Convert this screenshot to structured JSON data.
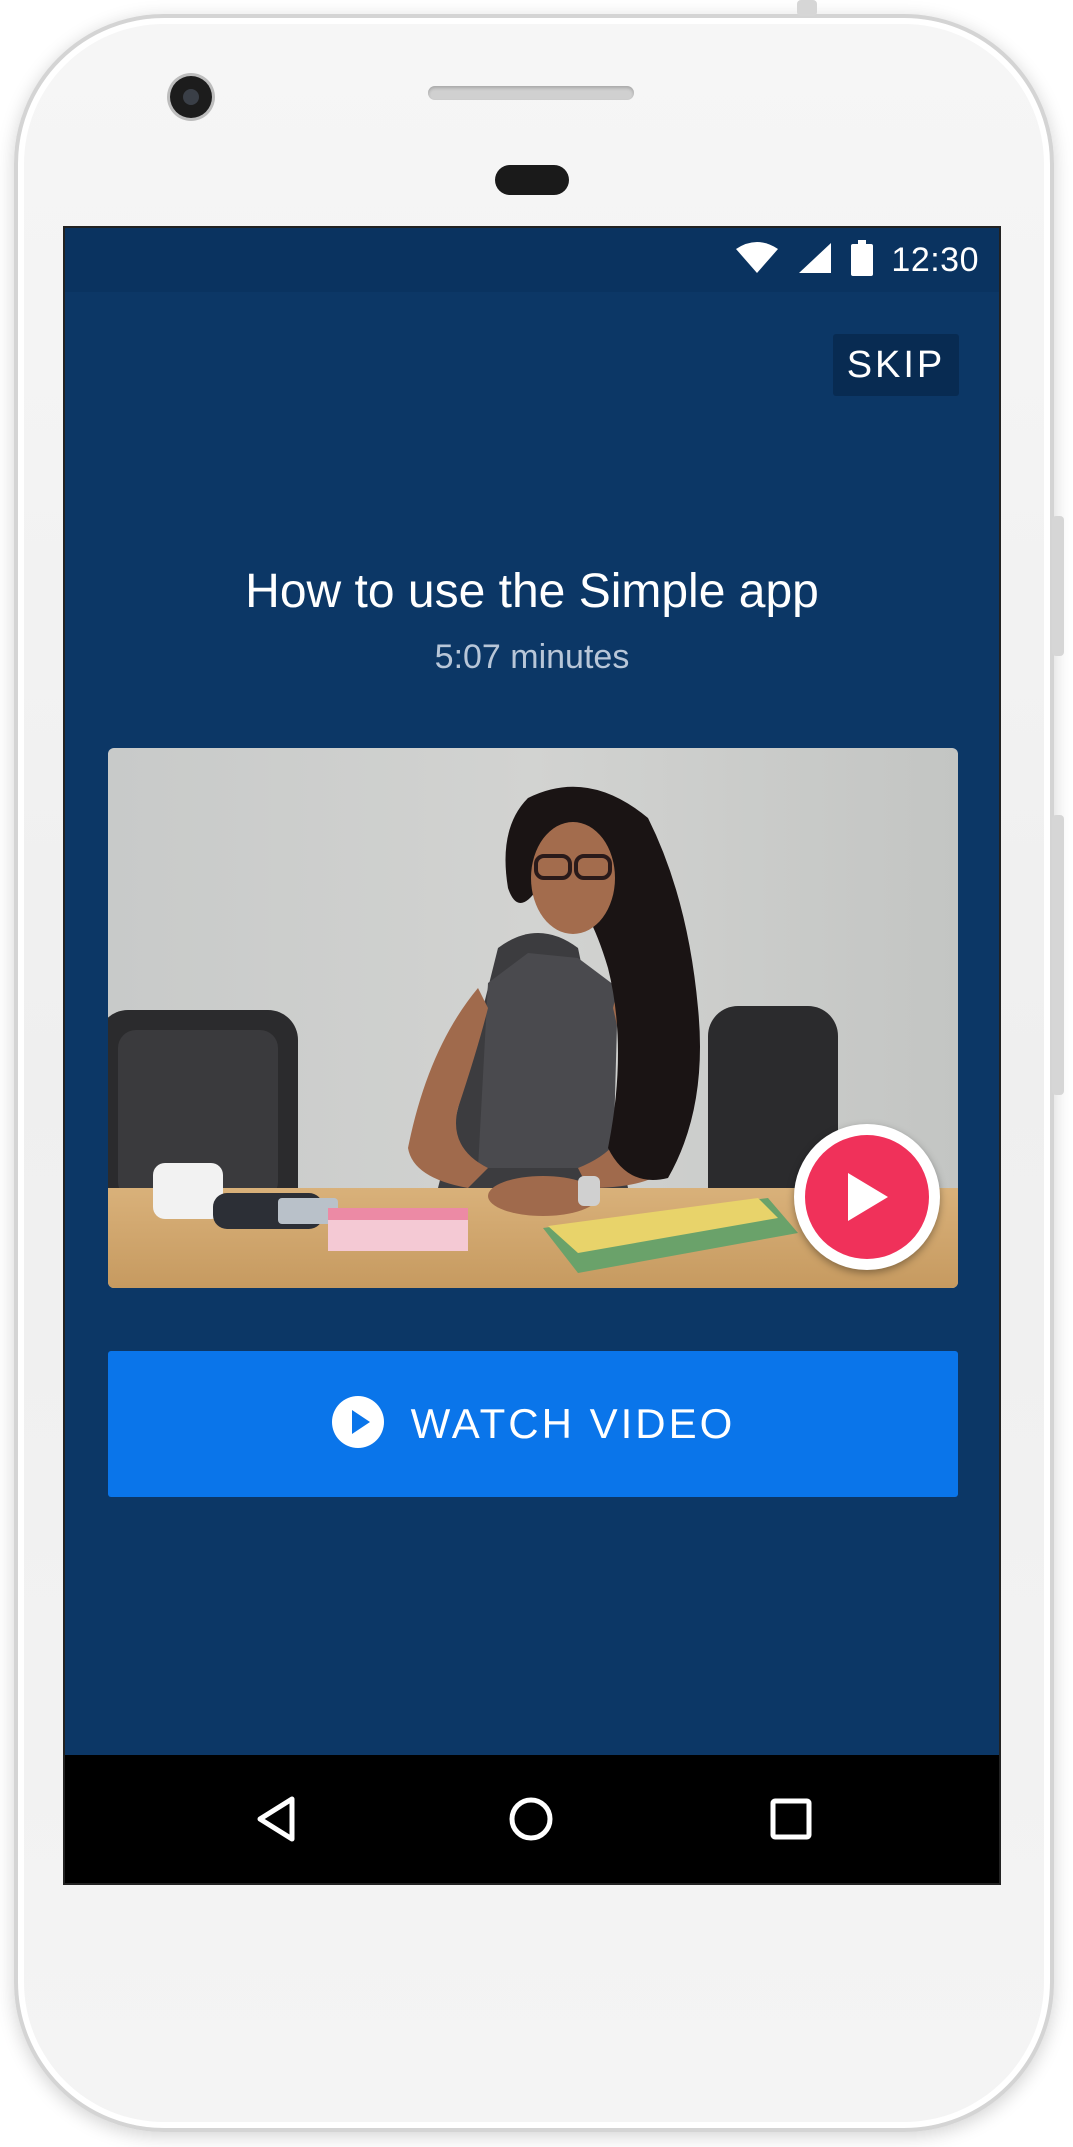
{
  "status_bar": {
    "time": "12:30",
    "icons": [
      "wifi-icon",
      "cellular-signal-icon",
      "battery-icon"
    ]
  },
  "header": {
    "skip_label": "SKIP"
  },
  "video": {
    "title": "How to use the Simple app",
    "duration": "5:07 minutes",
    "thumbnail_description_icon": "video-thumbnail",
    "play_icon": "play-icon"
  },
  "actions": {
    "watch_label": "WATCH VIDEO",
    "watch_icon": "play-circle-icon"
  },
  "navigation": {
    "items": [
      "back-icon",
      "home-icon",
      "recents-icon"
    ]
  },
  "colors": {
    "screen_background": "#0c3766",
    "status_bar": "#0a3360",
    "skip_background": "#082b52",
    "primary_button": "#0a75ea",
    "play_accent": "#f0315a",
    "subtitle_text": "#b8c6d8"
  }
}
